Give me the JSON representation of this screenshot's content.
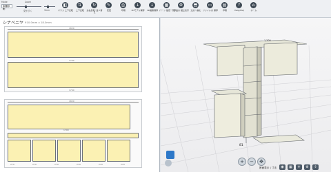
{
  "toolbar": {
    "view_label": "Mode",
    "view_value": "本棚印刷",
    "zoom_label": "Zoom",
    "zoom_small": "見やすく",
    "zoom_value": "3mm",
    "buttons": [
      {
        "icon": "layer-icon",
        "glyph": "◧",
        "label": "マウス\n上下反転"
      },
      {
        "icon": "flip-icon",
        "glyph": "⇅",
        "label": "上下反転"
      },
      {
        "icon": "rotate-icon",
        "glyph": "↻",
        "label": "左右反転/\n並べ替え"
      },
      {
        "icon": "edit-icon",
        "glyph": "✎",
        "label": "変更"
      },
      {
        "icon": "print-icon",
        "glyph": "⎙",
        "label": "印刷"
      },
      {
        "icon": "download-icon",
        "glyph": "↓",
        "label": "3Dモデル保存"
      },
      {
        "icon": "save-icon",
        "glyph": "↓",
        "label": "3D画像保存"
      },
      {
        "icon": "part-icon",
        "glyph": "▦",
        "label": "パーツ\n設定一覧"
      },
      {
        "icon": "assembly-icon",
        "glyph": "⚙",
        "label": "部品の\n組立表示"
      },
      {
        "icon": "cart-icon",
        "glyph": "⬒",
        "label": "注文へ進む"
      },
      {
        "icon": "folder-icon",
        "glyph": "▭",
        "label": "ファイルの\n保存"
      },
      {
        "icon": "open-icon",
        "glyph": "▤",
        "label": "印刷"
      },
      {
        "icon": "help-icon",
        "glyph": "?",
        "label": "Help/FAQ"
      },
      {
        "icon": "home-icon",
        "glyph": "⌂",
        "label": "ホーム"
      }
    ]
  },
  "left_pane": {
    "title": "シナベニヤ",
    "dims": "910.0mm x 18.0mm",
    "sheet1": {
      "top_dim": "1820",
      "mid_dim": "1790",
      "bottom_dim": "1790"
    },
    "sheet2": {
      "top_dim": "1820",
      "mid_dim": "1700",
      "bottom_dims": [
        "279",
        "279",
        "279",
        "279",
        "279",
        "279"
      ]
    }
  },
  "viewport": {
    "top_label": "1,200",
    "height_label": "81",
    "view_text": "断面表示 | 寸法",
    "nav_icons": [
      "zoom-in-icon",
      "zoom-out-icon",
      "pan-icon"
    ],
    "tool_icons": [
      "camera-icon",
      "grid-icon",
      "light-icon",
      "settings-icon",
      "share-icon"
    ]
  },
  "colors": {
    "panel": "#fbf1b3",
    "accent": "#2d78c8",
    "shelf": "#e8e8d8"
  }
}
